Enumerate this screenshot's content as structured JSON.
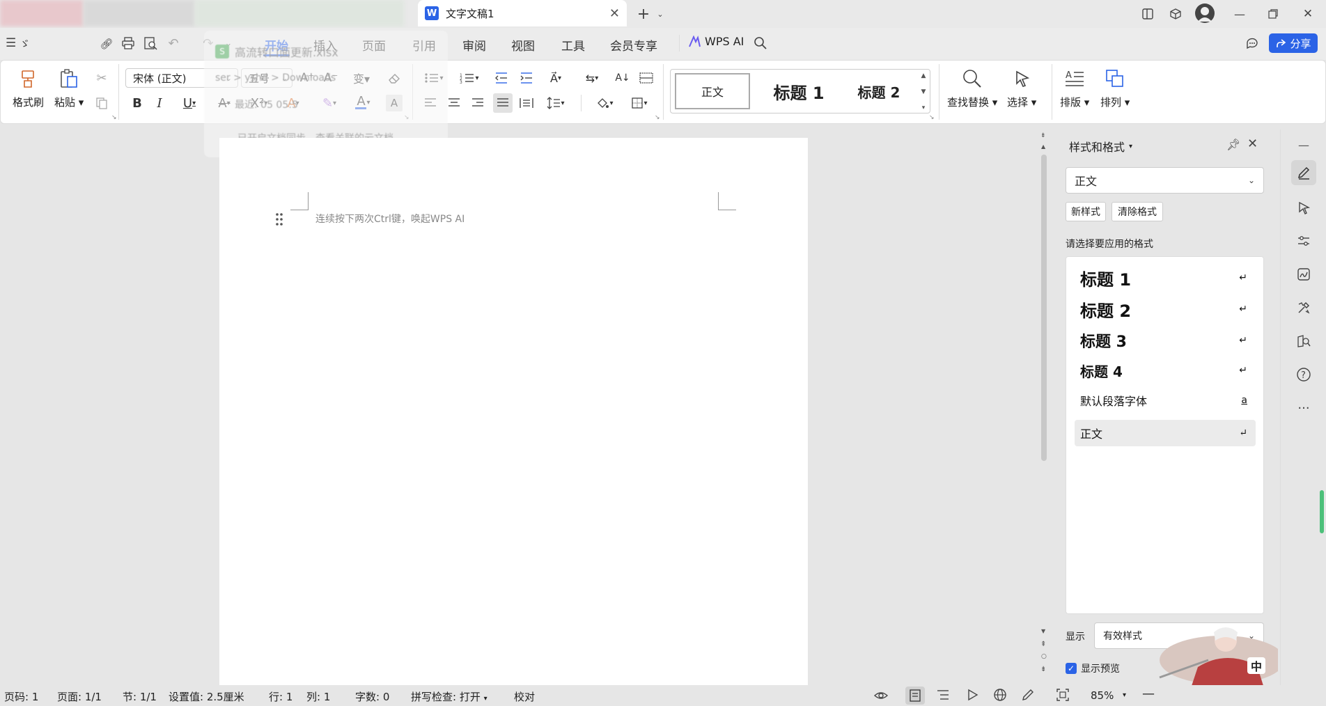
{
  "titlebar": {
    "tab_title": "文字文稿1",
    "tab_icon": "W"
  },
  "menu": {
    "items": [
      "开始",
      "插入",
      "页面",
      "引用",
      "审阅",
      "视图",
      "工具",
      "会员专享"
    ],
    "active": "开始",
    "wps_ai": "WPS AI",
    "share": "分享"
  },
  "ribbon": {
    "format_painter": "格式刷",
    "paste": "粘贴",
    "font_name": "宋体 (正文)",
    "font_size": "五号",
    "styles": [
      "正文",
      "标题 1",
      "标题 2"
    ],
    "find_replace": "查找替换",
    "select": "选择",
    "layout": "排版",
    "arrange": "排列"
  },
  "popup": {
    "file": "高流转口面更新.xlsx",
    "path": "ser > yshd > Downloads",
    "recent": "最近: 05 05:5",
    "sync": "已开启文档同步，查看关联的云文档"
  },
  "document": {
    "hint": "连续按下两次Ctrl键，唤起WPS AI"
  },
  "side_panel": {
    "title": "样式和格式",
    "current_style": "正文",
    "new_style": "新样式",
    "clear_format": "清除格式",
    "prompt": "请选择要应用的格式",
    "styles": [
      {
        "label": "标题 1",
        "mark": "↵"
      },
      {
        "label": "标题 2",
        "mark": "↵"
      },
      {
        "label": "标题 3",
        "mark": "↵"
      },
      {
        "label": "标题 4",
        "mark": "↵"
      },
      {
        "label": "默认段落字体",
        "mark": "a"
      },
      {
        "label": "正文",
        "mark": "↵"
      }
    ],
    "show_label": "显示",
    "show_value": "有效样式",
    "preview_label": "显示预览",
    "ime": "中"
  },
  "statusbar": {
    "page_num": "页码: 1",
    "pages": "页面: 1/1",
    "section": "节: 1/1",
    "setting": "设置值: 2.5厘米",
    "row": "行: 1",
    "col": "列: 1",
    "words": "字数: 0",
    "spell": "拼写检查: 打开",
    "proof": "校对",
    "zoom": "85%"
  },
  "colors": {
    "accent": "#2b63e6",
    "active_tab": "#2b63e6"
  }
}
